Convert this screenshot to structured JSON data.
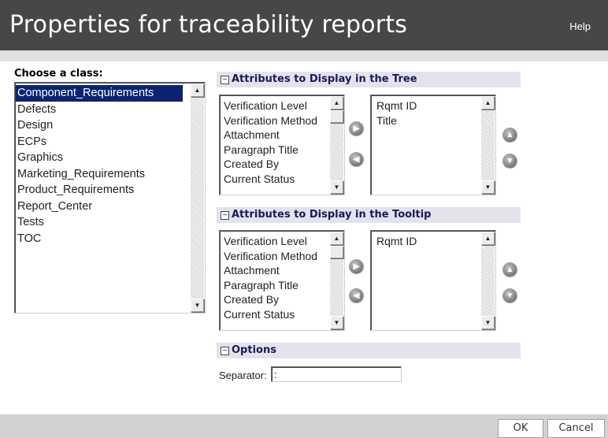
{
  "header": {
    "title": "Properties for traceability reports",
    "help_label": "Help"
  },
  "classes": {
    "label": "Choose a class:",
    "items": [
      {
        "label": "Component_Requirements"
      },
      {
        "label": "Defects"
      },
      {
        "label": "Design"
      },
      {
        "label": "ECPs"
      },
      {
        "label": "Graphics"
      },
      {
        "label": "Marketing_Requirements"
      },
      {
        "label": "Product_Requirements"
      },
      {
        "label": "Report_Center"
      },
      {
        "label": "Tests"
      },
      {
        "label": "TOC"
      }
    ],
    "selected": "Component_Requirements"
  },
  "tree_section": {
    "title": "Attributes to Display in the Tree",
    "toggle": "−",
    "available": [
      "Verification Level",
      "Verification Method",
      "Attachment",
      "Paragraph Title",
      "Created By",
      "Current Status"
    ],
    "selected": [
      "Rqmt ID",
      "Title"
    ]
  },
  "tooltip_section": {
    "title": "Attributes to Display in the Tooltip",
    "toggle": "−",
    "available": [
      "Verification Level",
      "Verification Method",
      "Attachment",
      "Paragraph Title",
      "Created By",
      "Current Status"
    ],
    "selected": [
      "Rqmt ID"
    ]
  },
  "options_section": {
    "title": "Options",
    "toggle": "−",
    "separator_label": "Separator:",
    "separator_value": ":"
  },
  "footer": {
    "ok_label": "OK",
    "cancel_label": "Cancel"
  },
  "icons": {
    "move_right": "right-arrow-icon",
    "move_left": "left-arrow-icon",
    "move_up": "up-arrow-icon",
    "move_down": "down-arrow-icon"
  },
  "colors": {
    "title_bar": "#474747",
    "selection": "#0a2470",
    "section_header": "#e3e3ee",
    "section_text": "#1a1a55"
  }
}
